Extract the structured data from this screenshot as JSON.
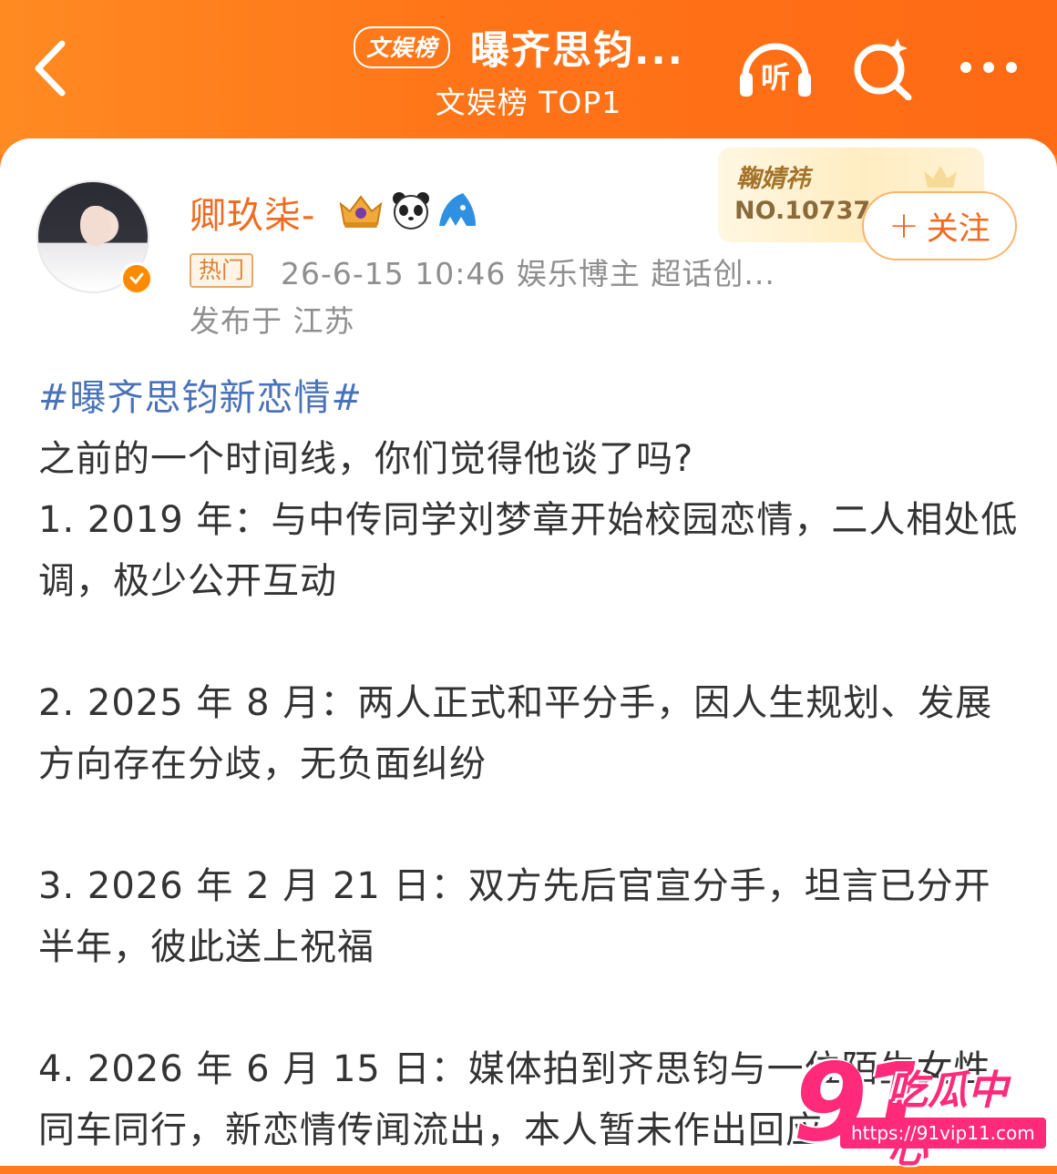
{
  "header": {
    "back_icon": "chevron-left-icon",
    "board_badge": "文娱榜",
    "title": "曝齐思钧...",
    "subtitle": "文娱榜 TOP1",
    "listen_label": "听",
    "search_icon": "sparkle-search-icon",
    "more_icon": "more-dots-icon",
    "accent_color": "#ff7418"
  },
  "author": {
    "name": "卿玖柒-",
    "badges": [
      "crown-medal-icon",
      "panda-icon",
      "shark-icon"
    ],
    "verified_icon": "verified-badge-icon",
    "hot_tag": "热门",
    "meta": "26-6-15 10:46  娱乐博主 超话创...",
    "location": "发布于 江苏",
    "rank_name": "鞠婧祎",
    "rank_no": "NO.107378",
    "follow_label": "关注",
    "follow_prefix": "+"
  },
  "post": {
    "hashtag": "#曝齐思钧新恋情#",
    "intro": "之前的一个时间线，你们觉得他谈了吗?",
    "items": [
      "1. 2019 年：与中传同学刘梦章开始校园恋情，二人相处低调，极少公开互动",
      "2. 2025 年 8 月：两人正式和平分手，因人生规划、发展方向存在分歧，无负面纠纷",
      "3. 2026 年 2 月 21 日：双方先后官宣分手，坦言已分开半年，彼此送上祝福",
      "4. 2026 年 6 月 15 日：媒体拍到齐思钧与一位陌生女性同车同行，新恋情传闻流出，本人暂未作出回应"
    ],
    "hashtag_color": "#4a72b8"
  },
  "watermark": {
    "number": "91",
    "text": "吃瓜中心",
    "url": "https://91vip11.com"
  }
}
